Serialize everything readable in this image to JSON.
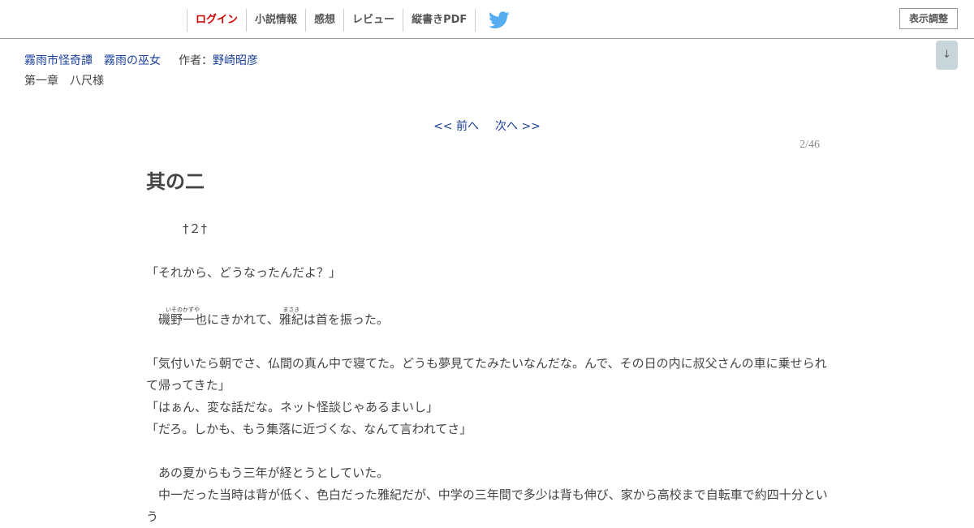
{
  "header": {
    "nav": [
      {
        "label": "ログイン"
      },
      {
        "label": "小説情報"
      },
      {
        "label": "感想"
      },
      {
        "label": "レビュー"
      },
      {
        "label": "縦書きPDF"
      }
    ],
    "twitter_icon": "twitter-bird-icon",
    "twitter_color": "#55acee",
    "display_button": "表示調整",
    "scroll_button": "↓"
  },
  "novel": {
    "series": "霧雨市怪奇譚",
    "title": "霧雨の巫女",
    "author_label": "作者：",
    "author": "野崎昭彦",
    "chapter": "第一章　八尺様"
  },
  "pager": {
    "prev": "<< 前へ",
    "next": "次へ >>",
    "page": "2/46"
  },
  "episode": {
    "title": "其の二",
    "lines": {
      "l1": "　　　†２†",
      "l2": "",
      "l3": "「それから、どうなったんだよ？」",
      "l4": "",
      "l5a_base": "磯野一也",
      "l5a_ruby": "いそのかずや",
      "l5b": "にきかれて、",
      "l5c_base": "雅紀",
      "l5c_ruby": "まさき",
      "l5d": "は首を振った。",
      "l6": "",
      "l7": "「気付いたら朝でさ、仏間の真ん中で寝てた。どうも夢見てたみたいなんだな。んで、その日の内に叔父さんの車に乗せられて帰ってきた」",
      "l8": "「はぁん、変な話だな。ネット怪談じゃあるまいし」",
      "l9": "「だろ。しかも、もう集落に近づくな、なんて言われてさ」",
      "l10": "",
      "l11": "　あの夏からもう三年が経とうとしていた。",
      "l12": "　中一だった当時は背が低く、色白だった雅紀だが、中学の三年間で多少は背も伸び、家から高校まで自転車で約四十分という"
    }
  }
}
